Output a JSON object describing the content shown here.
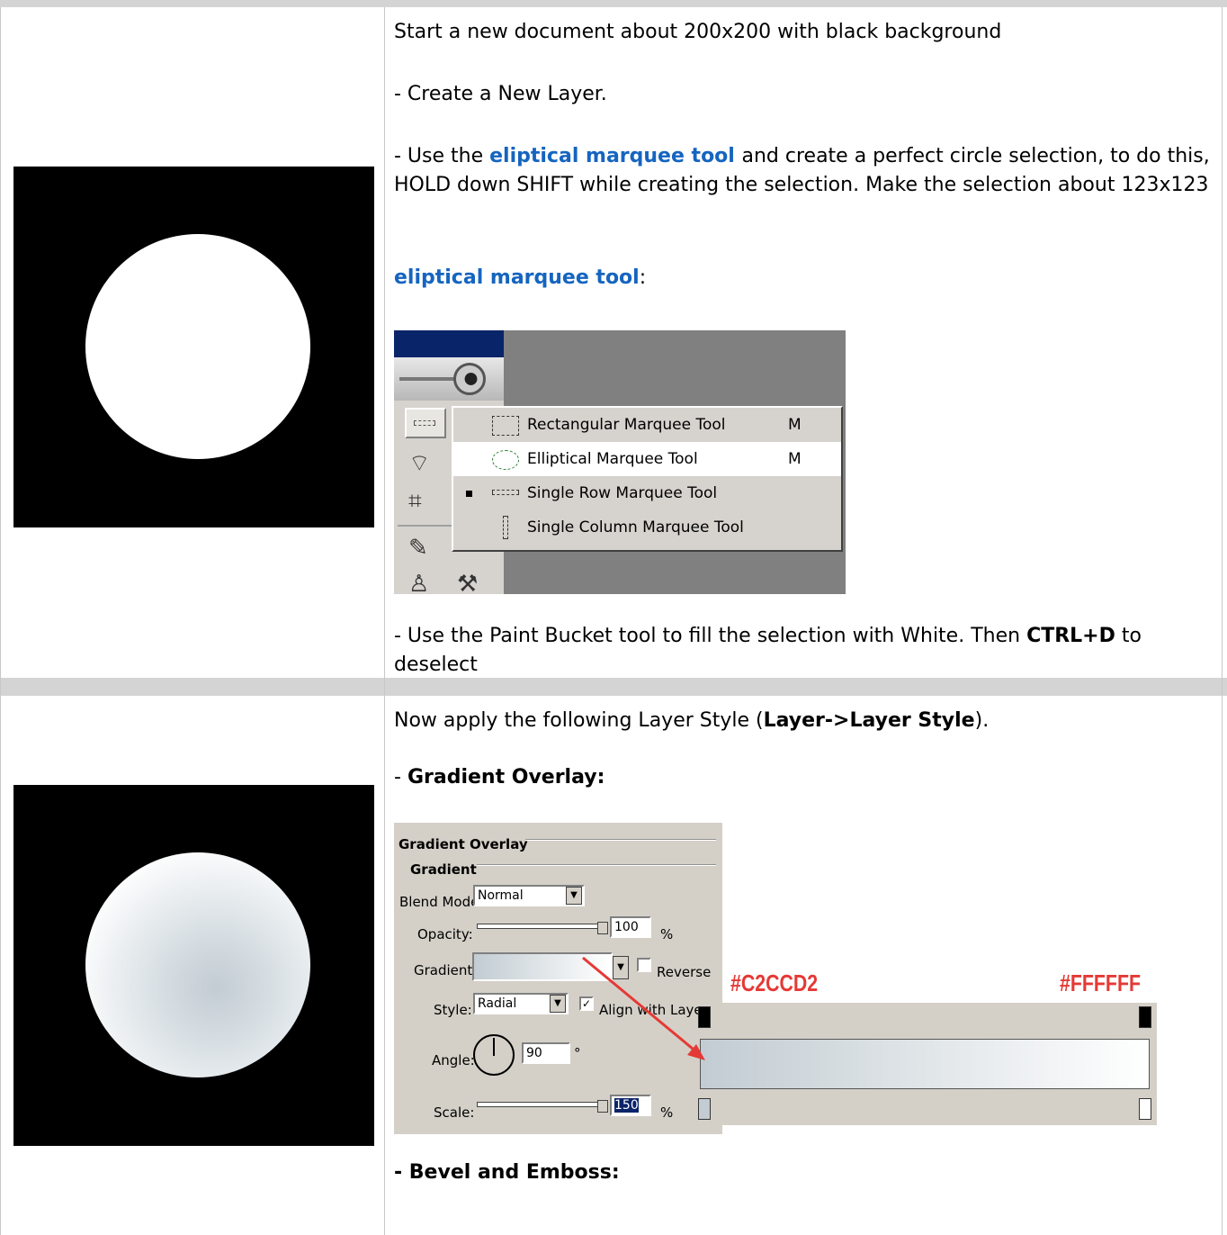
{
  "theme": {
    "link": "#1565c0",
    "separator": "#d4d4d4",
    "annotation": "#e53935"
  },
  "step1": {
    "p1": "Start a new document about 200x200 with black background",
    "p2": "- Create a New Layer.",
    "p3_pre": "- Use the ",
    "p3_link": "eliptical marquee tool ",
    "p3_post": "and create a perfect circle selection, to do this, HOLD down SHIFT while creating the selection. Make the selection about 123x123",
    "tool_heading": "eliptical marquee tool",
    "tool_heading_suffix": ":",
    "p4_pre": "- Use the Paint Bucket tool to fill the selection with White. Then ",
    "p4_bold": "CTRL+D",
    "p4_post": " to deselect",
    "menu": [
      {
        "label": "Rectangular Marquee Tool",
        "key": "M",
        "icon": "rectangular-marquee-icon"
      },
      {
        "label": "Elliptical Marquee Tool",
        "key": "M",
        "icon": "elliptical-marquee-icon"
      },
      {
        "label": "Single Row Marquee Tool",
        "key": "",
        "icon": "single-row-marquee-icon"
      },
      {
        "label": "Single Column Marquee Tool",
        "key": "",
        "icon": "single-column-marquee-icon"
      }
    ]
  },
  "step2": {
    "p1_pre": "Now apply the following Layer Style (",
    "p1_bold": "Layer->Layer Style",
    "p1_post": ").",
    "gradient_prefix": "- ",
    "gradient_heading": "Gradient Overlay:",
    "bevel_heading": "- Bevel and Emboss:",
    "panel": {
      "title": "Gradient Overlay",
      "group": "Gradient",
      "blend_mode_label": "Blend Mode:",
      "blend_mode_value": "Normal",
      "opacity_label": "Opacity:",
      "opacity_value": "100",
      "percent": "%",
      "gradient_label": "Gradient:",
      "reverse_label": "Reverse",
      "style_label": "Style:",
      "style_value": "Radial",
      "align_label": "Align with Layer",
      "angle_label": "Angle:",
      "angle_value": "90",
      "degree": "°",
      "scale_label": "Scale:",
      "scale_value": "150"
    },
    "gradient_colors": {
      "start": "#C2CCD2",
      "end": "#FFFFFF"
    }
  }
}
